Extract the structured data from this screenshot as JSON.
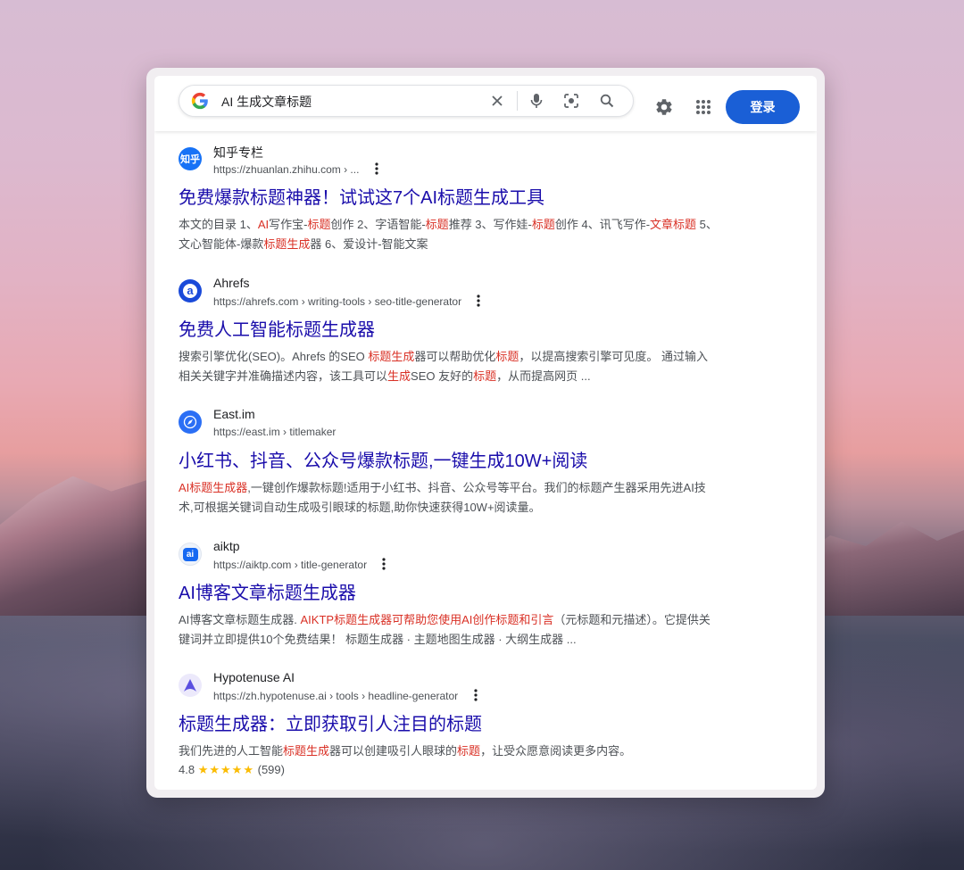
{
  "search": {
    "query": "AI 生成文章标题"
  },
  "header": {
    "login_label": "登录"
  },
  "icons": {
    "google": "google-g-logo",
    "clear": "close-icon",
    "mic": "mic-icon",
    "lens": "camera-lens-icon",
    "search": "search-icon",
    "settings": "gear-icon",
    "apps": "apps-grid-icon",
    "more": "more-vert-icon"
  },
  "colors": {
    "link": "#1a0dab",
    "highlight": "#d93025",
    "login_button": "#1a5fd6",
    "star": "#fbbc04"
  },
  "results": [
    {
      "site": "知乎专栏",
      "url": "https://zhuanlan.zhihu.com › ...",
      "favicon_text": "知乎",
      "title": "免费爆款标题神器！试试这7个AI标题生成工具",
      "snippet_lines": [
        [
          {
            "t": "本文的目录 1、",
            "h": false
          },
          {
            "t": "AI",
            "h": true
          },
          {
            "t": "写作宝-",
            "h": false
          },
          {
            "t": "标题",
            "h": true
          },
          {
            "t": "创作 2、字语智能-",
            "h": false
          },
          {
            "t": "标题",
            "h": true
          },
          {
            "t": "推荐 3、写作娃-",
            "h": false
          },
          {
            "t": "标题",
            "h": true
          },
          {
            "t": "创作 4、讯飞写作-",
            "h": false
          },
          {
            "t": "文章标题",
            "h": true
          },
          {
            "t": " 5、",
            "h": false
          }
        ],
        [
          {
            "t": "文心智能体-爆款",
            "h": false
          },
          {
            "t": "标题生成",
            "h": true
          },
          {
            "t": "器 6、爱设计-智能文案",
            "h": false
          }
        ]
      ]
    },
    {
      "site": "Ahrefs",
      "url": "https://ahrefs.com › writing-tools › seo-title-generator",
      "favicon_text": "a",
      "title": "免费人工智能标题生成器",
      "snippet_lines": [
        [
          {
            "t": "搜索引擎优化(SEO)。Ahrefs 的SEO ",
            "h": false
          },
          {
            "t": "标题生成",
            "h": true
          },
          {
            "t": "器可以帮助优化",
            "h": false
          },
          {
            "t": "标题",
            "h": true
          },
          {
            "t": "，以提高搜索引擎可见度。 通过输入",
            "h": false
          }
        ],
        [
          {
            "t": "相关关键字并准确描述内容，该工具可以",
            "h": false
          },
          {
            "t": "生成",
            "h": true
          },
          {
            "t": "SEO 友好的",
            "h": false
          },
          {
            "t": "标题",
            "h": true
          },
          {
            "t": "，从而提高网页 ...",
            "h": false
          }
        ]
      ]
    },
    {
      "site": "East.im",
      "url": "https://east.im › titlemaker",
      "favicon_text": "",
      "title": "小红书、抖音、公众号爆款标题,一键生成10W+阅读",
      "snippet_lines": [
        [
          {
            "t": "AI标题生成器",
            "h": true
          },
          {
            "t": ",一键创作爆款标题!适用于小红书、抖音、公众号等平台。我们的标题产生器采用先进AI技",
            "h": false
          }
        ],
        [
          {
            "t": "术,可根据关键词自动生成吸引眼球的标题,助你快速获得10W+阅读量。",
            "h": false
          }
        ]
      ]
    },
    {
      "site": "aiktp",
      "url": "https://aiktp.com › title-generator",
      "favicon_text": "ai",
      "title": "AI博客文章标题生成器",
      "snippet_lines": [
        [
          {
            "t": "AI博客文章标题生成器. ",
            "h": false
          },
          {
            "t": "AIKTP标题生成器可帮助您使用AI创作标题和引言",
            "h": true
          },
          {
            "t": "（元标题和元描述）。它提供关",
            "h": false
          }
        ],
        [
          {
            "t": "键词并立即提供10个免费结果！ 标题生成器 · 主题地图生成器 · 大纲生成器 ...",
            "h": false
          }
        ]
      ]
    },
    {
      "site": "Hypotenuse AI",
      "url": "https://zh.hypotenuse.ai › tools › headline-generator",
      "favicon_text": "",
      "title": "标题生成器：立即获取引人注目的标题",
      "snippet_lines": [
        [
          {
            "t": "我们先进的人工智能",
            "h": false
          },
          {
            "t": "标题生成",
            "h": true
          },
          {
            "t": "器可以创建吸引人眼球的",
            "h": false
          },
          {
            "t": "标题",
            "h": true
          },
          {
            "t": "，让受众愿意阅读更多内容。",
            "h": false
          }
        ]
      ],
      "rating": {
        "value": "4.8",
        "stars": "★★★★★",
        "count": "(599)"
      }
    }
  ]
}
